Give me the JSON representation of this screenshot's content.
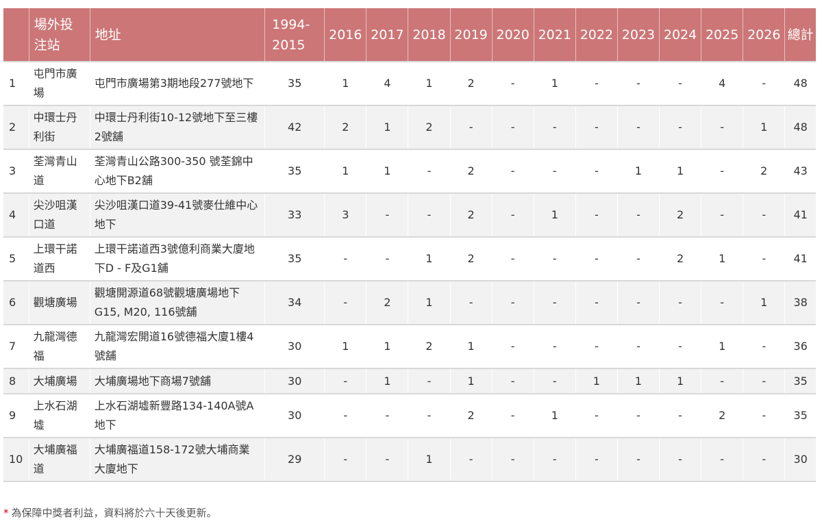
{
  "table": {
    "headers": {
      "rank": "",
      "station": "場外投注站",
      "address": "地址",
      "period": "1994-2015",
      "years": [
        "2016",
        "2017",
        "2018",
        "2019",
        "2020",
        "2021",
        "2022",
        "2023",
        "2024",
        "2025",
        "2026"
      ],
      "total": "總計"
    },
    "rows": [
      {
        "rank": "1",
        "station": "屯門市廣場",
        "address": "屯門市廣場第3期地段277號地下",
        "period": "35",
        "years": [
          "1",
          "4",
          "1",
          "2",
          "-",
          "1",
          "-",
          "-",
          "-",
          "4",
          "-"
        ],
        "total": "48"
      },
      {
        "rank": "2",
        "station": "中環士丹利街",
        "address": "中環士丹利街10-12號地下至三樓2號舖",
        "period": "42",
        "years": [
          "2",
          "1",
          "2",
          "-",
          "-",
          "-",
          "-",
          "-",
          "-",
          "-",
          "1"
        ],
        "total": "48"
      },
      {
        "rank": "3",
        "station": "荃灣青山道",
        "address": "荃灣青山公路300-350 號荃錦中心地下B2舖",
        "period": "35",
        "years": [
          "1",
          "1",
          "-",
          "2",
          "-",
          "-",
          "-",
          "1",
          "1",
          "-",
          "2"
        ],
        "total": "43"
      },
      {
        "rank": "4",
        "station": "尖沙咀漢口道",
        "address": "尖沙咀漢口道39-41號麥仕維中心地下",
        "period": "33",
        "years": [
          "3",
          "-",
          "-",
          "2",
          "-",
          "1",
          "-",
          "-",
          "2",
          "-",
          "-"
        ],
        "total": "41"
      },
      {
        "rank": "5",
        "station": "上環干諾道西",
        "address": "上環干諾道西3號億利商業大廈地下D - F及G1舖",
        "period": "35",
        "years": [
          "-",
          "-",
          "1",
          "2",
          "-",
          "-",
          "-",
          "-",
          "2",
          "1",
          "-"
        ],
        "total": "41"
      },
      {
        "rank": "6",
        "station": "觀塘廣場",
        "address": "觀塘開源道68號觀塘廣場地下G15, M20, 116號舖",
        "period": "34",
        "years": [
          "-",
          "2",
          "1",
          "-",
          "-",
          "-",
          "-",
          "-",
          "-",
          "-",
          "1"
        ],
        "total": "38"
      },
      {
        "rank": "7",
        "station": "九龍灣德福",
        "address": "九龍灣宏開道16號德福大廈1樓4號舖",
        "period": "30",
        "years": [
          "1",
          "1",
          "2",
          "1",
          "-",
          "-",
          "-",
          "-",
          "-",
          "1",
          "-"
        ],
        "total": "36"
      },
      {
        "rank": "8",
        "station": "大埔廣場",
        "address": "大埔廣場地下商場7號舖",
        "period": "30",
        "years": [
          "-",
          "1",
          "-",
          "1",
          "-",
          "-",
          "1",
          "1",
          "1",
          "-",
          "-"
        ],
        "total": "35"
      },
      {
        "rank": "9",
        "station": "上水石湖墟",
        "address": "上水石湖墟新豐路134-140A號A地下",
        "period": "30",
        "years": [
          "-",
          "-",
          "-",
          "2",
          "-",
          "1",
          "-",
          "-",
          "-",
          "2",
          "-"
        ],
        "total": "35"
      },
      {
        "rank": "10",
        "station": "大埔廣福道",
        "address": "大埔廣福道158-172號大埔商業大廈地下",
        "period": "29",
        "years": [
          "-",
          "-",
          "1",
          "-",
          "-",
          "-",
          "-",
          "-",
          "-",
          "-",
          "-"
        ],
        "total": "30"
      }
    ]
  },
  "footnote": {
    "marker": "*",
    "text": "為保障中獎者利益，資料將於六十天後更新。"
  },
  "colors": {
    "header_bg": "#cc7677",
    "header_text": "#ffffff",
    "stripe_bg": "#f2f2f2",
    "footnote_marker": "#d0021b"
  }
}
